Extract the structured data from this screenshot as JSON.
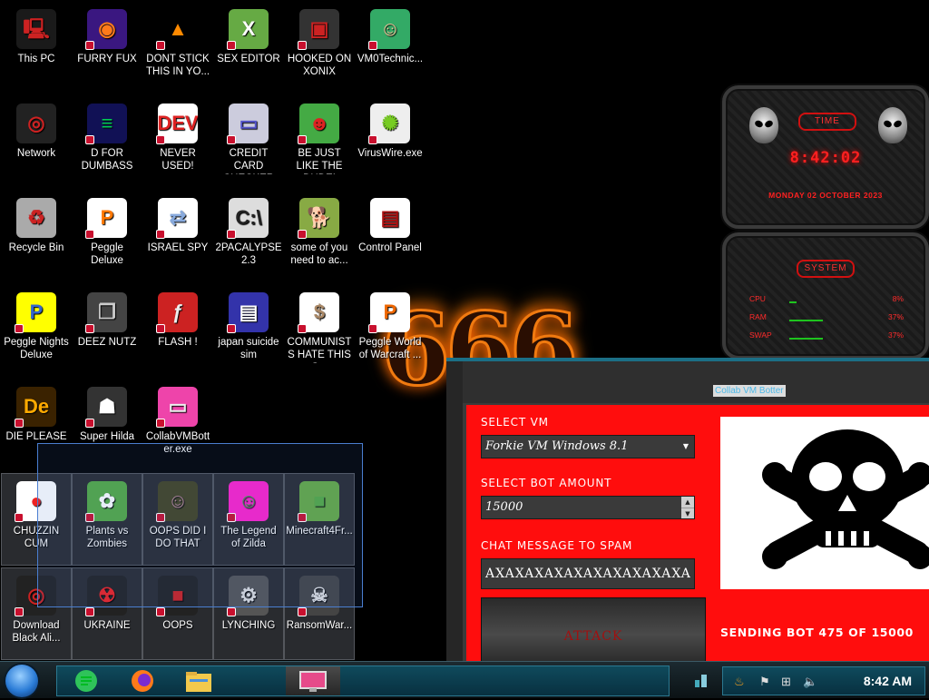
{
  "desktop": {
    "icons": [
      {
        "label": "This PC",
        "icon": "computer-icon"
      },
      {
        "label": "FURRY FUX",
        "icon": "firefox-icon"
      },
      {
        "label": "DONT STICK THIS IN YO...",
        "icon": "vlc-cone-icon"
      },
      {
        "label": "SEX EDITOR",
        "icon": "hxd-icon"
      },
      {
        "label": "HOOKED ON XONIX",
        "icon": "xonix-icon"
      },
      {
        "label": "VM0Technic...",
        "icon": "doctor-icon"
      },
      {
        "label": "Network",
        "icon": "network-icon"
      },
      {
        "label": "D FOR DUMBASS",
        "icon": "discord-icon"
      },
      {
        "label": "NEVER USED!",
        "icon": "devcpp-icon"
      },
      {
        "label": "CREDIT CARD CHECKER",
        "icon": "credit-card-icon"
      },
      {
        "label": "BE JUST LIKE THE DUDE!",
        "icon": "santa-icon"
      },
      {
        "label": "VirusWire.exe",
        "icon": "limewire-icon"
      },
      {
        "label": "Recycle Bin",
        "icon": "recycle-bin-icon"
      },
      {
        "label": "Peggle Deluxe",
        "icon": "peggle-icon"
      },
      {
        "label": "ISRAEL SPY",
        "icon": "network-spy-icon"
      },
      {
        "label": "2PACALYPSE 2.3",
        "icon": "terminal-icon"
      },
      {
        "label": "some of you need to ac...",
        "icon": "dog-icon"
      },
      {
        "label": "Control Panel",
        "icon": "control-panel-icon"
      },
      {
        "label": "Peggle Nights Deluxe",
        "icon": "peggle-nights-icon"
      },
      {
        "label": "DEEZ NUTZ",
        "icon": "stacked-windows-icon"
      },
      {
        "label": "FLASH !",
        "icon": "flash-icon"
      },
      {
        "label": "japan suicide sim",
        "icon": "document-icon"
      },
      {
        "label": "COMMUNISTS HATE THIS G...",
        "icon": "money-bag-icon"
      },
      {
        "label": "Peggle World of Warcraft ...",
        "icon": "peggle-wow-icon"
      },
      {
        "label": "DIE PLEASE",
        "icon": "after-effects-icon"
      },
      {
        "label": "Super Hilda",
        "icon": "pixel-character-icon"
      },
      {
        "label": "CollabVMBotter.exe",
        "icon": "monitor-icon"
      },
      {
        "label": "CHUZZIN CUM",
        "icon": "chuzzle-icon"
      },
      {
        "label": "Plants vs Zombies",
        "icon": "pvz-icon"
      },
      {
        "label": "OOPS DID I DO THAT",
        "icon": "portrait-icon"
      },
      {
        "label": "The Legend of Zilda",
        "icon": "link-icon"
      },
      {
        "label": "Minecraft4Fr...",
        "icon": "minecraft-icon"
      },
      {
        "label": "Download Black Ali...",
        "icon": "alienware-icon"
      },
      {
        "label": "UKRAINE",
        "icon": "radiation-icon"
      },
      {
        "label": "OOPS",
        "icon": "red-app-icon"
      },
      {
        "label": "LYNCHING",
        "icon": "gear-ghost-icon"
      },
      {
        "label": "RansomWar...",
        "icon": "skull-ring-icon"
      }
    ]
  },
  "clock_gadget": {
    "title": "TIME",
    "time": "8:42:02",
    "date": "MONDAY 02 OCTOBER 2023"
  },
  "system_gadget": {
    "title": "SYSTEM",
    "rows": [
      {
        "label": "CPU",
        "value": "8%",
        "level": 0.08
      },
      {
        "label": "RAM",
        "value": "37%",
        "level": 0.37
      },
      {
        "label": "SWAP",
        "value": "37%",
        "level": 0.37
      }
    ]
  },
  "bot_window": {
    "title": "Collab VM Botter",
    "select_vm_label": "SELECT VM",
    "select_vm_value": "Forkie VM Windows 8.1",
    "bot_amount_label": "SELECT BOT AMOUNT",
    "bot_amount_value": "15000",
    "chat_label": "CHAT MESSAGE TO SPAM",
    "chat_value": "AXAXAXAXAXAXAXAXAXAXA",
    "attack_label": "ATTACK",
    "status": "SENDING BOT 475 OF 15000",
    "progress": 0.032
  },
  "taskbar": {
    "time": "8:42 AM",
    "pinned": [
      "discord-icon",
      "firefox-icon",
      "file-explorer-icon",
      "collabvm-botter-icon"
    ]
  },
  "wallpaper": {
    "text": "666"
  },
  "colors": {
    "accent_red": "#ff0d0d",
    "taskbar_teal": "#0f4a5c",
    "gadget_red": "#ff2020"
  }
}
